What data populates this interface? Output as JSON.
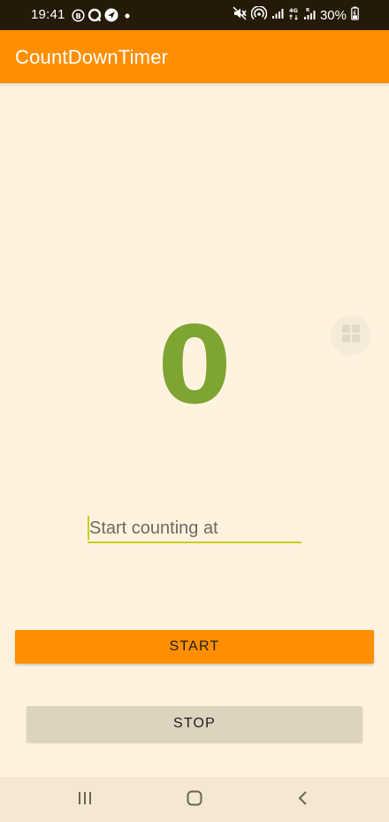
{
  "status_bar": {
    "time": "19:41",
    "battery": "30%",
    "left_icons": [
      "b-badge-icon",
      "chat-bubble-icon",
      "navigation-icon",
      "dot-icon"
    ],
    "right_icons": [
      "mute-icon",
      "hotspot-icon",
      "signal-icon",
      "data-4g-icon",
      "signal-r-icon",
      "battery-icon"
    ]
  },
  "app_bar": {
    "title": "CountDownTimer",
    "color": "#FF8F00"
  },
  "countdown": {
    "value": "0",
    "color": "#7EA432"
  },
  "input": {
    "placeholder": "Start counting at",
    "value": "",
    "underline_color": "#C6CF1C"
  },
  "buttons": {
    "start_label": "START",
    "stop_label": "STOP"
  },
  "overlay": {
    "icon": "grid-icon"
  },
  "nav_bar": {
    "icons": [
      "recent-apps-icon",
      "home-icon",
      "back-icon"
    ]
  }
}
